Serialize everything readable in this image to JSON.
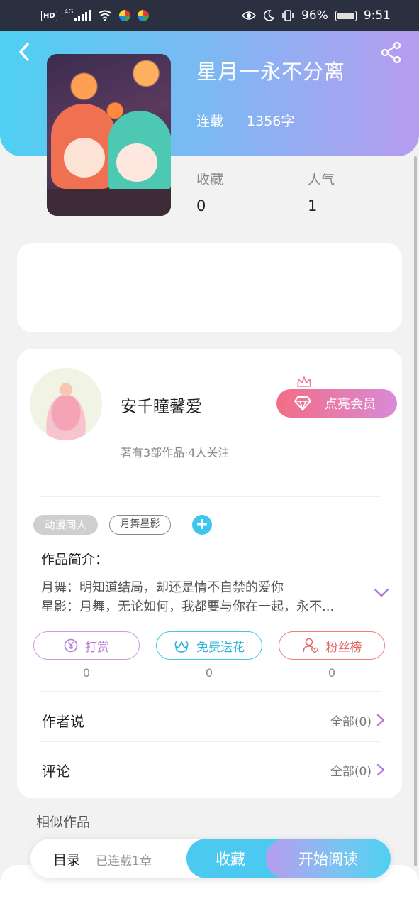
{
  "status_bar": {
    "hd": "HD",
    "network": "4G",
    "battery": "96%",
    "time": "9:51"
  },
  "book": {
    "title": "星月一永不分离",
    "status": "连载",
    "word_count": "1356字",
    "stats": [
      {
        "label": "收藏",
        "value": "0"
      },
      {
        "label": "人气",
        "value": "1"
      }
    ]
  },
  "author": {
    "name": "安千瞳馨爱",
    "summary": "著有3部作品·4人关注",
    "vip_label": "点亮会员"
  },
  "tags": [
    "动漫同人",
    "月舞星影"
  ],
  "intro": {
    "title": "作品简介：",
    "lines": [
      "月舞：明知道结局，却还是情不自禁的爱你",
      "星影：月舞，无论如何，我都要与你在一起，永不..."
    ]
  },
  "actions": [
    {
      "label": "打赏",
      "count": "0",
      "icon": "yen-coin-icon",
      "color": "#b57bd9"
    },
    {
      "label": "免费送花",
      "count": "0",
      "icon": "flower-icon",
      "color": "#2ab3dc"
    },
    {
      "label": "粉丝榜",
      "count": "0",
      "icon": "fan-user-icon",
      "color": "#e66666"
    }
  ],
  "rows": [
    {
      "title": "作者说",
      "right": "全部(0)"
    },
    {
      "title": "评论",
      "right": "全部(0)"
    }
  ],
  "similar_title": "相似作品",
  "bottom_bar": {
    "toc": "目录",
    "chapters": "已连载1章",
    "favorite": "收藏",
    "read": "开始阅读"
  }
}
